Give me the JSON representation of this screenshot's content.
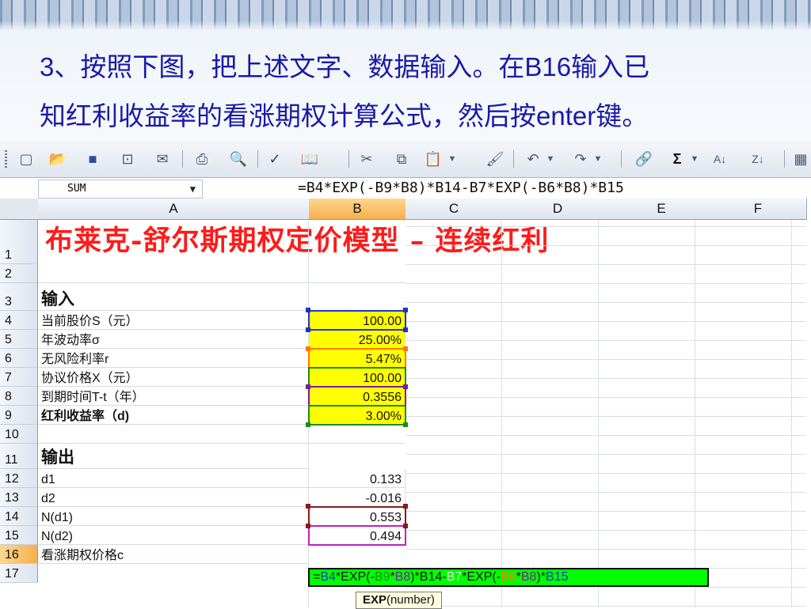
{
  "slide": {
    "instruction_line1": "3、按照下图，把上述文字、数据输入。在B16输入已",
    "instruction_line2": "知红利收益率的看涨期权计算公式，然后按enter键。"
  },
  "toolbar": {
    "icons": [
      "new-icon",
      "open-icon",
      "save-icon",
      "permission-icon",
      "email-icon",
      "print-icon",
      "print-preview-icon",
      "spelling-icon",
      "research-icon",
      "cut-icon",
      "copy-icon",
      "paste-icon",
      "format-painter-icon",
      "undo-icon",
      "redo-icon",
      "hyperlink-icon",
      "autosum-icon",
      "sort-ascending-icon",
      "sort-descending-icon"
    ],
    "autosum_glyph": "Σ"
  },
  "formula_bar": {
    "name_box": "SUM",
    "formula": "=B4*EXP(-B9*B8)*B14-B7*EXP(-B6*B8)*B15"
  },
  "columns": [
    "A",
    "B",
    "C",
    "D",
    "E",
    "F"
  ],
  "rows": [
    "1",
    "2",
    "3",
    "4",
    "5",
    "6",
    "7",
    "8",
    "9",
    "10",
    "11",
    "12",
    "13",
    "14",
    "15",
    "16",
    "17"
  ],
  "sheet": {
    "title": "布莱克-舒尔斯期权定价模型 – 连续红利",
    "input_heading": "输入",
    "labels": {
      "r4": "当前股价S（元）",
      "r5": "年波动率σ",
      "r6": "无风险利率r",
      "r7": "协议价格X（元）",
      "r8": "到期时间T-t（年）",
      "r9": "红利收益率（d)",
      "r12": "d1",
      "r13": "d2",
      "r14": "N(d1)",
      "r15": "N(d2)",
      "r16": "看涨期权价格c"
    },
    "output_heading": "输出",
    "values": {
      "r4": "100.00",
      "r5": "25.00%",
      "r6": "5.47%",
      "r7": "100.00",
      "r8": "0.3556",
      "r9": "3.00%",
      "r12": "0.133",
      "r13": "-0.016",
      "r14": "0.553",
      "r15": "0.494"
    }
  },
  "edit_cell": {
    "p1": "=",
    "p2": "B4",
    "p3": "*EXP(-",
    "p4": "B9",
    "p5": "*",
    "p6": "B8",
    "p7": ")*B14-",
    "p8": "B7",
    "p9": "*EXP(-",
    "p10": "B6",
    "p11": "*",
    "p12": "B8",
    "p13": ")*",
    "p14": "B15"
  },
  "tooltip": {
    "func": "EXP",
    "args": "(number)"
  },
  "colors": {
    "title_red": "#ff1a1a",
    "input_yellow": "#ffff00",
    "editing_green": "#00ff00",
    "instruction_blue": "#1a1aa8"
  }
}
